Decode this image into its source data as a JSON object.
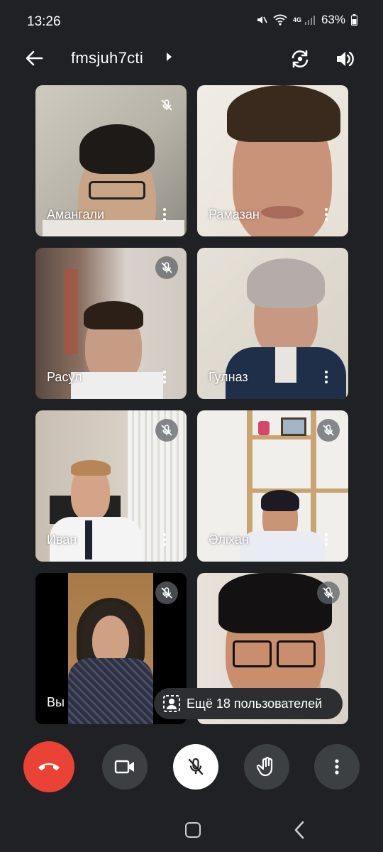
{
  "status_bar": {
    "time": "13:26",
    "network": "4G",
    "battery": "63%"
  },
  "header": {
    "meeting_code": "fmsjuh7cti"
  },
  "participants": [
    {
      "name": "Амангали",
      "muted": true
    },
    {
      "name": "Рамазан",
      "muted": false
    },
    {
      "name": "Расул",
      "muted": true
    },
    {
      "name": "Гулназ",
      "muted": false
    },
    {
      "name": "Иван",
      "muted": true
    },
    {
      "name": "Әліхан",
      "muted": true
    },
    {
      "name": "Вы",
      "muted": true
    },
    {
      "name": "",
      "muted": true
    }
  ],
  "more_participants": {
    "label": "Ещё 18 пользователей"
  },
  "controls": {
    "end_call": "end-call",
    "camera": "camera",
    "microphone": "mic-off",
    "raise_hand": "hand",
    "more": "more"
  },
  "colors": {
    "background": "#202124",
    "end_call": "#ea4335",
    "control": "#3c4043"
  }
}
